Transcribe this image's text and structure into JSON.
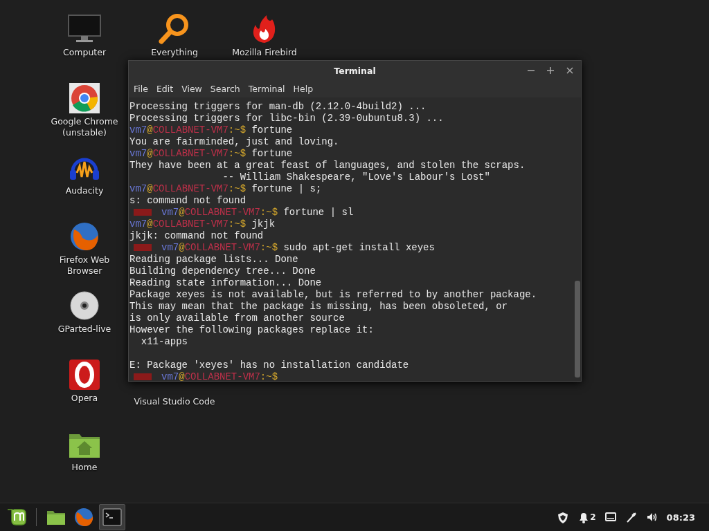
{
  "desktop_icons": [
    {
      "label": "Computer"
    },
    {
      "label": "Everything"
    },
    {
      "label": "Mozilla Firebird"
    },
    {
      "label": "Google Chrome (unstable)"
    },
    {
      "label": "Audacity"
    },
    {
      "label": "Firefox Web Browser"
    },
    {
      "label": "GParted-live"
    },
    {
      "label": "Opera"
    },
    {
      "label": "Visual Studio Code"
    },
    {
      "label": "Home"
    }
  ],
  "window": {
    "title": "Terminal",
    "menu": [
      "File",
      "Edit",
      "View",
      "Search",
      "Terminal",
      "Help"
    ],
    "lines": [
      {
        "kind": "output",
        "text": "Processing triggers for man-db (2.12.0-4build2) ..."
      },
      {
        "kind": "output",
        "text": "Processing triggers for libc-bin (2.39-0ubuntu8.3) ..."
      },
      {
        "kind": "prompt",
        "error": false,
        "user": "vm7",
        "at": "@",
        "host": "COLLABNET-VM7",
        "path": ":~$",
        "command": "fortune"
      },
      {
        "kind": "output",
        "text": "You are fairminded, just and loving."
      },
      {
        "kind": "prompt",
        "error": false,
        "user": "vm7",
        "at": "@",
        "host": "COLLABNET-VM7",
        "path": ":~$",
        "command": "fortune"
      },
      {
        "kind": "output",
        "text": "They have been at a great feast of languages, and stolen the scraps."
      },
      {
        "kind": "output",
        "text": "                -- William Shakespeare, \"Love's Labour's Lost\""
      },
      {
        "kind": "prompt",
        "error": false,
        "user": "vm7",
        "at": "@",
        "host": "COLLABNET-VM7",
        "path": ":~$",
        "command": "fortune | s;"
      },
      {
        "kind": "output",
        "text": "s: command not found"
      },
      {
        "kind": "prompt",
        "error": true,
        "user": "vm7",
        "at": "@",
        "host": "COLLABNET-VM7",
        "path": ":~$",
        "command": "fortune | sl"
      },
      {
        "kind": "prompt",
        "error": false,
        "user": "vm7",
        "at": "@",
        "host": "COLLABNET-VM7",
        "path": ":~$",
        "command": "jkjk"
      },
      {
        "kind": "output",
        "text": "jkjk: command not found"
      },
      {
        "kind": "prompt",
        "error": true,
        "user": "vm7",
        "at": "@",
        "host": "COLLABNET-VM7",
        "path": ":~$",
        "command": "sudo apt-get install xeyes"
      },
      {
        "kind": "output",
        "text": "Reading package lists... Done"
      },
      {
        "kind": "output",
        "text": "Building dependency tree... Done"
      },
      {
        "kind": "output",
        "text": "Reading state information... Done"
      },
      {
        "kind": "output",
        "text": "Package xeyes is not available, but is referred to by another package."
      },
      {
        "kind": "output",
        "text": "This may mean that the package is missing, has been obsoleted, or"
      },
      {
        "kind": "output",
        "text": "is only available from another source"
      },
      {
        "kind": "output",
        "text": "However the following packages replace it:"
      },
      {
        "kind": "output",
        "text": "  x11-apps"
      },
      {
        "kind": "blank"
      },
      {
        "kind": "output",
        "text": "E: Package 'xeyes' has no installation candidate"
      },
      {
        "kind": "prompt",
        "error": true,
        "user": "vm7",
        "at": "@",
        "host": "COLLABNET-VM7",
        "path": ":~$"
      }
    ]
  },
  "taskbar": {
    "launchers": [
      {
        "selected": false
      },
      {
        "selected": false
      },
      {
        "selected": false
      },
      {
        "selected": true
      }
    ],
    "notification_count": "2",
    "clock": "08:23"
  }
}
